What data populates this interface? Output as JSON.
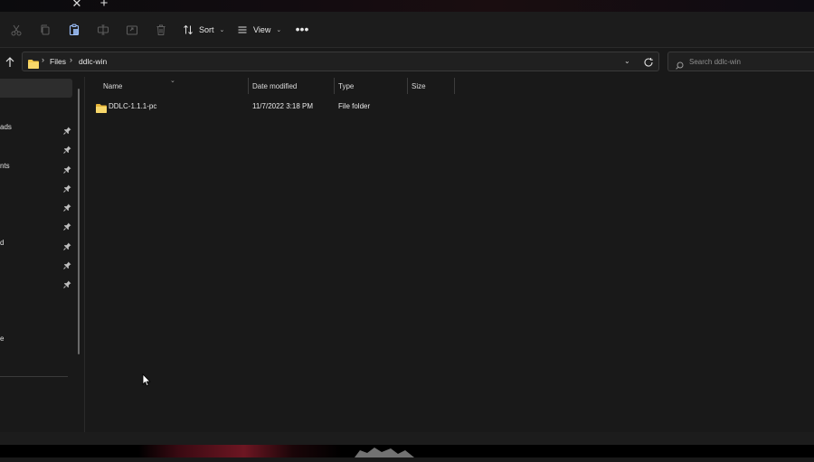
{
  "titlebar": {
    "close_tab_glyph": "✕",
    "new_tab_glyph": "+"
  },
  "commandbar": {
    "icons": [
      "cut-icon",
      "copy-icon",
      "paste-icon",
      "rename-icon",
      "share-icon",
      "delete-icon"
    ],
    "sort_label": "Sort",
    "view_label": "View",
    "more_glyph": "•••"
  },
  "address": {
    "crumbs": [
      "Files",
      "ddlc-win"
    ],
    "separator": "›"
  },
  "search": {
    "placeholder": "Search ddlc-win"
  },
  "nav": {
    "items": [
      "",
      "ads",
      "nts",
      "",
      "",
      "",
      "d",
      "",
      "",
      "e"
    ]
  },
  "columns": {
    "name": "Name",
    "date_modified": "Date modified",
    "type": "Type",
    "size": "Size"
  },
  "files": [
    {
      "name": "DDLC-1.1.1-pc",
      "date_modified": "11/7/2022 3:18 PM",
      "type": "File folder",
      "size": ""
    }
  ],
  "colors": {
    "background": "#191919",
    "folder": "#f2c94c",
    "selection": "#2d2d2d"
  }
}
